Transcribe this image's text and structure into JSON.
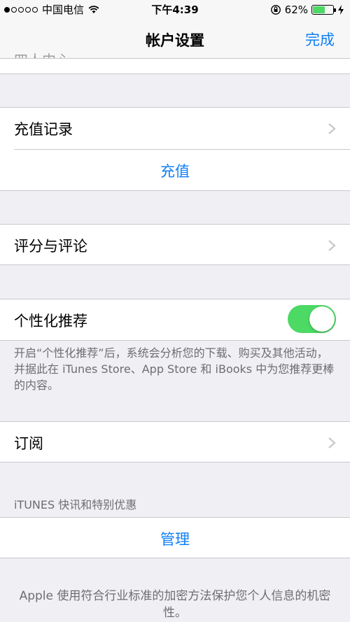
{
  "status": {
    "carrier": "中国电信",
    "time": "下午4:39",
    "battery": "62%",
    "battery_level": 0.62
  },
  "nav": {
    "title": "帐户设置",
    "done": "完成",
    "ghost": "四人中心"
  },
  "rows": {
    "recharge_history": "充值记录",
    "recharge": "充值",
    "rating": "评分与评论",
    "personalized": "个性化推荐",
    "subscriptions": "订阅",
    "manage": "管理"
  },
  "toggle": {
    "personalized_on": true
  },
  "footer": {
    "personalized_note": "开启“个性化推荐”后，系统会分析您的下载、购买及其他活动，并据此在 iTunes Store、App Store 和 iBooks 中为您推荐更棒的内容。",
    "itunes_header": "iTUNES 快讯和特别优惠",
    "security_note": "Apple 使用符合行业标准的加密方法保护您个人信息的机密性。"
  },
  "colors": {
    "accent": "#0e7ff5",
    "toggle_on": "#4cd964",
    "background": "#efeff4"
  }
}
